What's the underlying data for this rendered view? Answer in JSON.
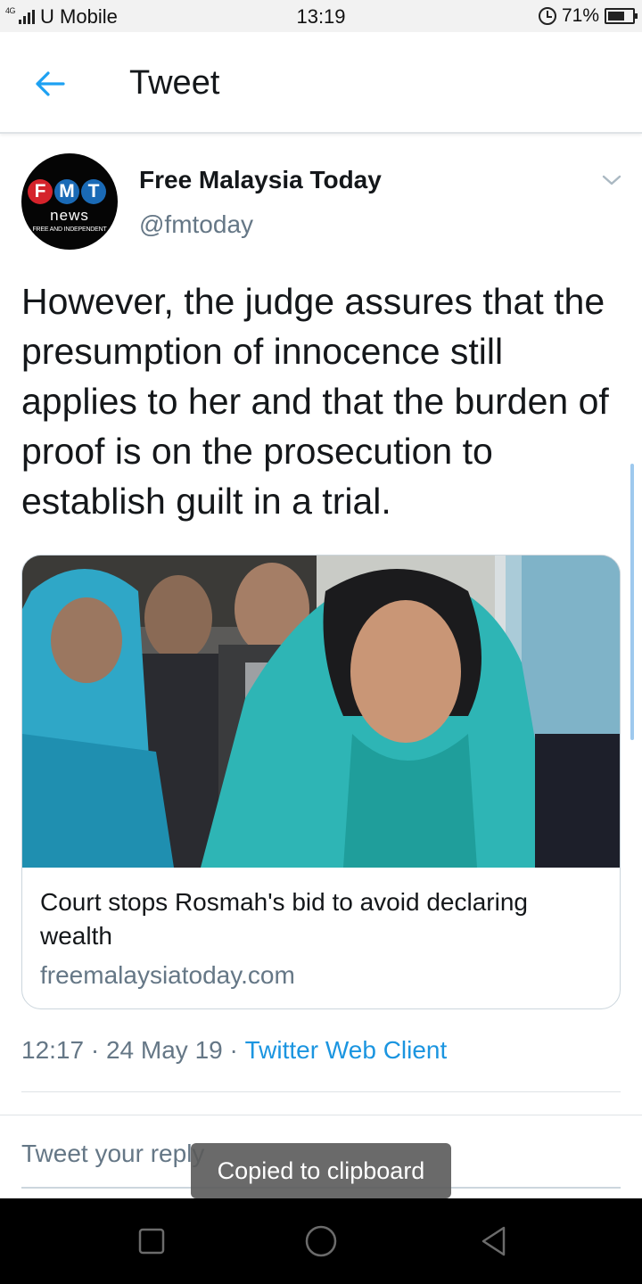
{
  "status_bar": {
    "network": "4G",
    "carrier": "U Mobile",
    "time": "13:19",
    "battery_percent": "71%",
    "battery_level": 0.71,
    "alarm_icon": "alarm-clock-icon"
  },
  "header": {
    "back_icon": "arrow-left-icon",
    "title": "Tweet"
  },
  "tweet": {
    "avatar": {
      "letters": [
        "F",
        "M",
        "T"
      ],
      "word": "news",
      "tagline": "FREE AND INDEPENDENT"
    },
    "author_name": "Free Malaysia Today",
    "author_handle": "@fmtoday",
    "caret_icon": "chevron-down-icon",
    "text": "However, the judge assures that the presumption of innocence still applies to her and that the burden of proof is on the prosecution to establish guilt in a trial.",
    "card": {
      "title": "Court stops Rosmah's bid to avoid declaring wealth",
      "domain": "freemalaysiatoday.com"
    },
    "time": "12:17",
    "separator": " · ",
    "date": "24 May 19",
    "source": "Twitter Web Client"
  },
  "reply": {
    "placeholder": "Tweet your reply"
  },
  "toast": {
    "message": "Copied to clipboard"
  },
  "nav_bar": {
    "recents_icon": "square-icon",
    "home_icon": "circle-icon",
    "back_icon": "triangle-back-icon"
  },
  "colors": {
    "accent": "#1da1f2",
    "link": "#1b95e0",
    "secondary_text": "#657786",
    "primary_text": "#14171a"
  }
}
